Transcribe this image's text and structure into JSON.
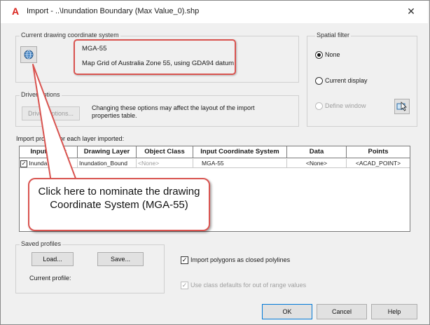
{
  "window": {
    "title": "Import - ..\\Inundation Boundary (Max Value_0).shp",
    "close_glyph": "✕"
  },
  "coord_system": {
    "group_title": "Current drawing coordinate system",
    "code": "MGA-55",
    "description": "Map Grid of Australia Zone 55, using GDA94 datum",
    "button_icon": "globe-icon"
  },
  "driver_options": {
    "group_title": "Driver options",
    "button_label": "Driver Options...",
    "note": "Changing these options may affect the layout of the import properties table."
  },
  "spatial_filter": {
    "group_title": "Spatial filter",
    "options": [
      {
        "label": "None",
        "selected": true,
        "enabled": true
      },
      {
        "label": "Current display",
        "selected": false,
        "enabled": true
      },
      {
        "label": "Define window",
        "selected": false,
        "enabled": false
      }
    ],
    "window_button_icon": "select-window-icon"
  },
  "profiles_table": {
    "caption": "Import profiles for each layer imported:",
    "columns": [
      "Input Layer",
      "Drawing Layer",
      "Object Class",
      "Input Coordinate System",
      "Data",
      "Points"
    ],
    "rows": [
      {
        "checked": true,
        "input_layer": "Inundation_Bou",
        "drawing_layer": "Inundation_Bound",
        "object_class": "<None>",
        "input_cs": "MGA-55",
        "data": "<None>",
        "points": "<ACAD_POINT>"
      }
    ]
  },
  "callout": {
    "text": "Click here to nominate the drawing Coordinate System (MGA-55)"
  },
  "saved_profiles": {
    "group_title": "Saved profiles",
    "load_label": "Load...",
    "save_label": "Save...",
    "current_profile_label": "Current profile:"
  },
  "options": {
    "closed_polylines_label": "Import polygons as closed polylines",
    "closed_polylines_checked": true,
    "class_defaults_label": "Use class defaults for out of range values",
    "class_defaults_checked": true
  },
  "footer": {
    "ok_label": "OK",
    "cancel_label": "Cancel",
    "help_label": "Help"
  },
  "colors": {
    "callout_border": "#d9534f",
    "autocad_logo": "#d9231c"
  }
}
